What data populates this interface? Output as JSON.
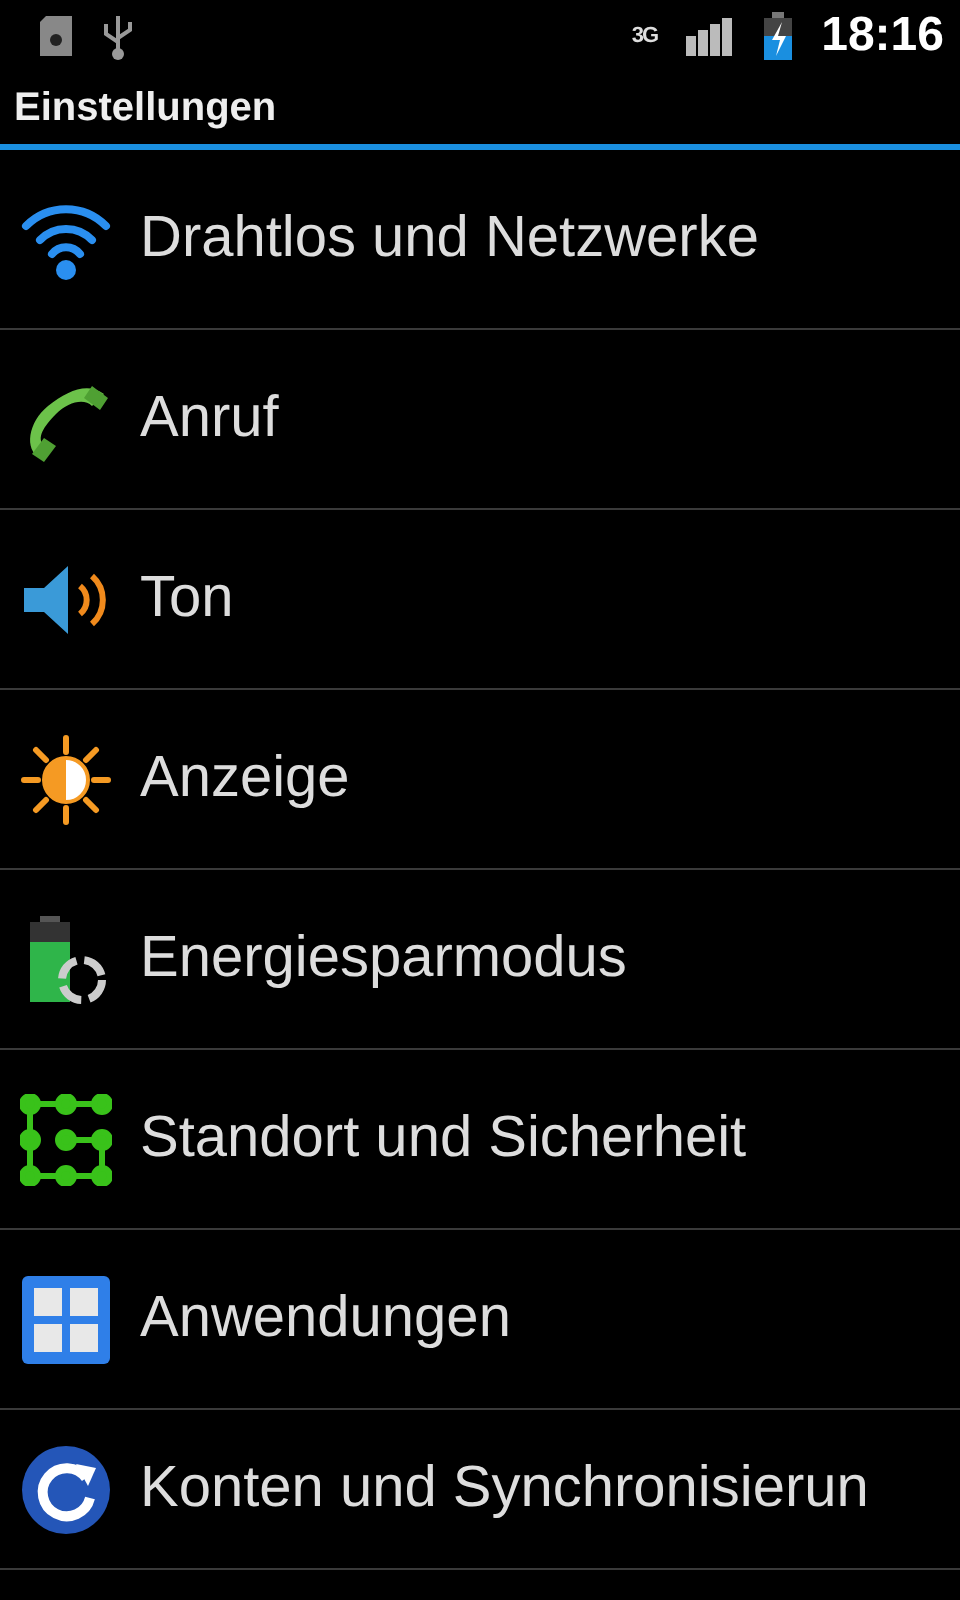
{
  "status_bar": {
    "network": "3G",
    "time": "18:16"
  },
  "title": "Einstellungen",
  "items": [
    {
      "label": "Drahtlos und Netzwerke"
    },
    {
      "label": "Anruf"
    },
    {
      "label": "Ton"
    },
    {
      "label": "Anzeige"
    },
    {
      "label": "Energiesparmodus"
    },
    {
      "label": "Standort und Sicherheit"
    },
    {
      "label": "Anwendungen"
    },
    {
      "label": "Konten und Synchronisierun"
    }
  ]
}
